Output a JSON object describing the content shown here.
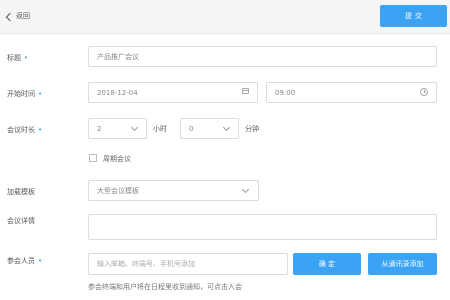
{
  "header": {
    "back_label": "返回",
    "submit_label": "提交"
  },
  "form": {
    "title": {
      "label": "标题",
      "value": "产品推广会议"
    },
    "start_time": {
      "label": "开始时间",
      "date": "2018-12-04",
      "time": "09:00"
    },
    "duration": {
      "label": "会议时长",
      "hours": "2",
      "hours_unit": "小时",
      "minutes": "0",
      "minutes_unit": "分钟"
    },
    "recurring": {
      "label": "周期会议",
      "checked": false
    },
    "template": {
      "label": "加载模板",
      "value": "大型会议模板"
    },
    "details": {
      "label": "会议详情",
      "value": ""
    },
    "participants": {
      "label": "参会人员",
      "placeholder": "输入邮箱、终端号、手机号添加",
      "confirm_label": "确 定",
      "contacts_label": "从通讯录添加",
      "hint": "参会终端和用户将在日程里收到通知，可点击入会"
    }
  },
  "colors": {
    "accent": "#3aa3f4",
    "required_marker": "#3aa3f4"
  },
  "icons": {
    "back": "chevron-left-icon",
    "date": "calendar-icon",
    "time": "clock-icon",
    "dropdown": "chevron-down-icon"
  }
}
